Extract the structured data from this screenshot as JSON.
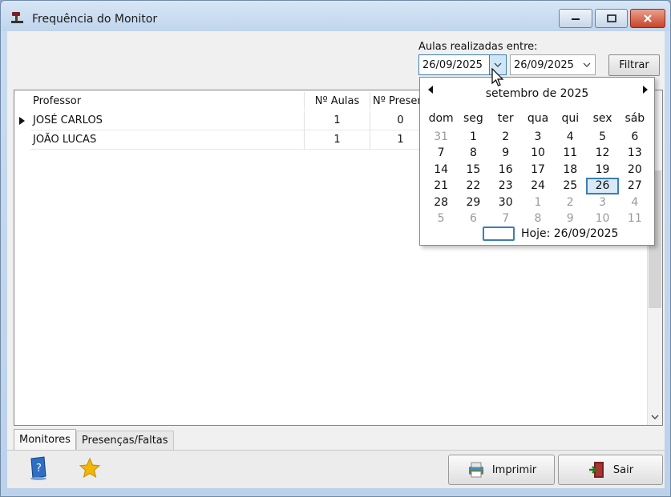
{
  "window": {
    "title": "Frequência do Monitor"
  },
  "filter": {
    "label": "Aulas realizadas entre:",
    "date_from": "26/09/2025",
    "date_to": "26/09/2025",
    "button_label": "Filtrar"
  },
  "grid": {
    "headers": [
      "Professor",
      "Nº Aulas",
      "Nº Presenç"
    ],
    "rows": [
      {
        "professor": "JOSÉ CARLOS",
        "aulas": "1",
        "presencas": "0",
        "current": true
      },
      {
        "professor": "JOÃO LUCAS",
        "aulas": "1",
        "presencas": "1",
        "current": false
      }
    ]
  },
  "calendar": {
    "month": "setembro de 2025",
    "weekdays": [
      "dom",
      "seg",
      "ter",
      "qua",
      "qui",
      "sex",
      "sáb"
    ],
    "weeks": [
      [
        "31",
        "1",
        "2",
        "3",
        "4",
        "5",
        "6"
      ],
      [
        "7",
        "8",
        "9",
        "10",
        "11",
        "12",
        "13"
      ],
      [
        "14",
        "15",
        "16",
        "17",
        "18",
        "19",
        "20"
      ],
      [
        "21",
        "22",
        "23",
        "24",
        "25",
        "26",
        "27"
      ],
      [
        "28",
        "29",
        "30",
        "1",
        "2",
        "3",
        "4"
      ],
      [
        "5",
        "6",
        "7",
        "8",
        "9",
        "10",
        "11"
      ]
    ],
    "selected_day": "26",
    "today_label": "Hoje: 26/09/2025"
  },
  "tabs": [
    {
      "label": "Monitores",
      "active": true
    },
    {
      "label": "Presenças/Faltas",
      "active": false
    }
  ],
  "actions": {
    "print_label": "Imprimir",
    "exit_label": "Sair"
  },
  "icons": {
    "app": "gavel-icon",
    "help": "help-book-icon",
    "favorite": "star-icon",
    "print": "printer-icon",
    "exit": "exit-door-icon"
  },
  "colors": {
    "accent": "#3c7fb1",
    "close_button": "#c8432a",
    "star": "#f2b705"
  }
}
